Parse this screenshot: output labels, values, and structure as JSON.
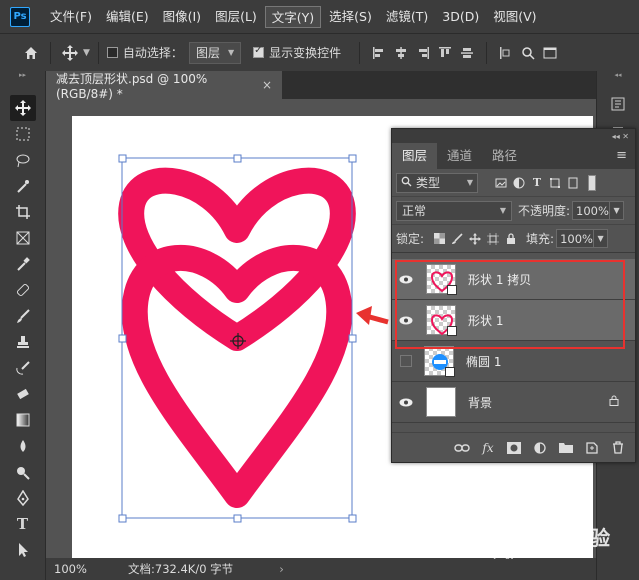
{
  "app": {
    "logo": "Ps"
  },
  "menu": [
    "文件(F)",
    "编辑(E)",
    "图像(I)",
    "图层(L)",
    "文字(Y)",
    "选择(S)",
    "滤镜(T)",
    "3D(D)",
    "视图(V)"
  ],
  "options": {
    "auto_select_label": "自动选择：",
    "auto_select_target": "图层",
    "show_transform_label": "显示变换控件"
  },
  "document": {
    "tab_title": "减去顶层形状.psd @ 100%(RGB/8#) *",
    "close": "×",
    "zoom": "100%",
    "doc_info": "文档:732.4K/0 字节",
    "status_arrow": "›"
  },
  "layers_panel": {
    "tabs": [
      "图层",
      "通道",
      "路径"
    ],
    "filter_label": "类型",
    "blend_mode": "正常",
    "opacity_label": "不透明度:",
    "opacity_value": "100%",
    "lock_label": "锁定:",
    "fill_label": "填充:",
    "fill_value": "100%",
    "layers": [
      {
        "name": "形状 1 拷贝",
        "visible": true,
        "selected": true
      },
      {
        "name": "形状 1",
        "visible": true,
        "selected": true
      },
      {
        "name": "椭圆 1",
        "visible": false,
        "selected": false
      },
      {
        "name": "背景",
        "visible": true,
        "selected": false,
        "locked": true
      }
    ]
  },
  "colors": {
    "shape_fill": "#f0145a",
    "highlight": "#e8322f",
    "selection": "#5a7dc8"
  },
  "watermark": {
    "text": "Bai du 经验",
    "sub": "jingyan.baidu.com"
  }
}
